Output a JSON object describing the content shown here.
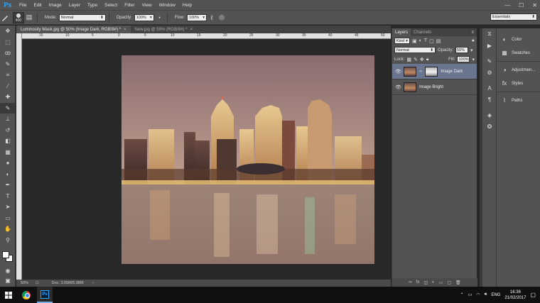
{
  "app": {
    "logo": "Ps"
  },
  "menu": [
    "File",
    "Edit",
    "Image",
    "Layer",
    "Type",
    "Select",
    "Filter",
    "View",
    "Window",
    "Help"
  ],
  "window_controls": {
    "minimize": "—",
    "maximize": "☐",
    "close": "✕"
  },
  "options_bar": {
    "brush_size": "400",
    "mode_label": "Mode:",
    "mode_value": "Normal",
    "opacity_label": "Opacity:",
    "opacity_value": "100%",
    "flow_label": "Flow:",
    "flow_value": "100%",
    "workspace": "Essentials"
  },
  "tools": [
    "move-icon",
    "marquee-icon",
    "lasso-icon",
    "quick-select-icon",
    "crop-icon",
    "eyedropper-icon",
    "healing-icon",
    "brush-icon",
    "stamp-icon",
    "history-brush-icon",
    "eraser-icon",
    "gradient-icon",
    "blur-icon",
    "dodge-icon",
    "pen-icon",
    "type-icon",
    "path-select-icon",
    "rectangle-icon",
    "hand-icon",
    "zoom-icon"
  ],
  "document_tabs": [
    {
      "label": "Luminosity Mask.jpg @ 50% (Image Dark, RGB/8#) *",
      "close": "×"
    },
    {
      "label": "New.jpg @ 50% (RGB/8#) *",
      "close": "×"
    }
  ],
  "ruler_top": [
    "15",
    "10",
    "5",
    "0",
    "5",
    "10",
    "15",
    "20",
    "25",
    "30",
    "35",
    "40",
    "45",
    "50"
  ],
  "status": {
    "zoom": "50%",
    "doc": "Doc: 3.65M/5.98M"
  },
  "layers_panel": {
    "tabs": [
      "Layers",
      "Channels"
    ],
    "kind_label": "Kind",
    "blend_mode": "Normal",
    "opacity_label": "Opacity:",
    "opacity_value": "50%",
    "lock_label": "Lock:",
    "fill_label": "Fill:",
    "fill_value": "100%",
    "layers": [
      {
        "name": "Image Dark",
        "selected": true,
        "has_mask": true
      },
      {
        "name": "Image Bright",
        "selected": false,
        "has_mask": false
      }
    ]
  },
  "right_panels": {
    "items": [
      {
        "label": "Color",
        "icon": "color-icon"
      },
      {
        "label": "Swatches",
        "icon": "swatches-icon"
      },
      {
        "label": "Adjustmen...",
        "icon": "adjustments-icon"
      },
      {
        "label": "Styles",
        "icon": "styles-icon"
      },
      {
        "label": "Paths",
        "icon": "paths-icon"
      }
    ]
  },
  "taskbar": {
    "language": "ENG",
    "time": "16:36",
    "date": "21/02/2017"
  },
  "colors": {
    "panel_bg": "#535353",
    "canvas_bg": "#282828",
    "selected_layer": "#6a7590",
    "ps_blue": "#31a8ff"
  }
}
